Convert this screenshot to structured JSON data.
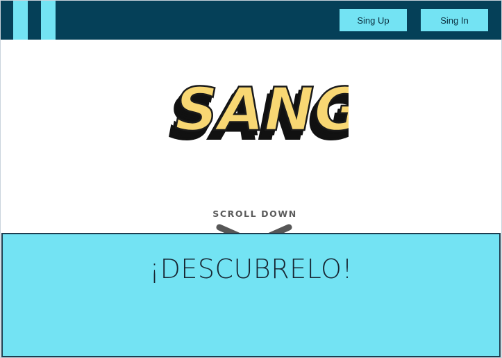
{
  "header": {
    "logo_icon": "two-vertical-bars-logo",
    "signup_label": "Sing Up",
    "signin_label": "Sing In",
    "colors": {
      "bar": "#054058",
      "accent": "#73e3f3"
    }
  },
  "hero": {
    "brand_logo_text": "SANGI",
    "scroll_label": "SCROLL DOWN",
    "scroll_icon": "chevron-down-icon"
  },
  "discover": {
    "title": "¡DESCUBRELO!",
    "colors": {
      "background": "#73e3f3",
      "border": "#1d3d4f"
    }
  }
}
